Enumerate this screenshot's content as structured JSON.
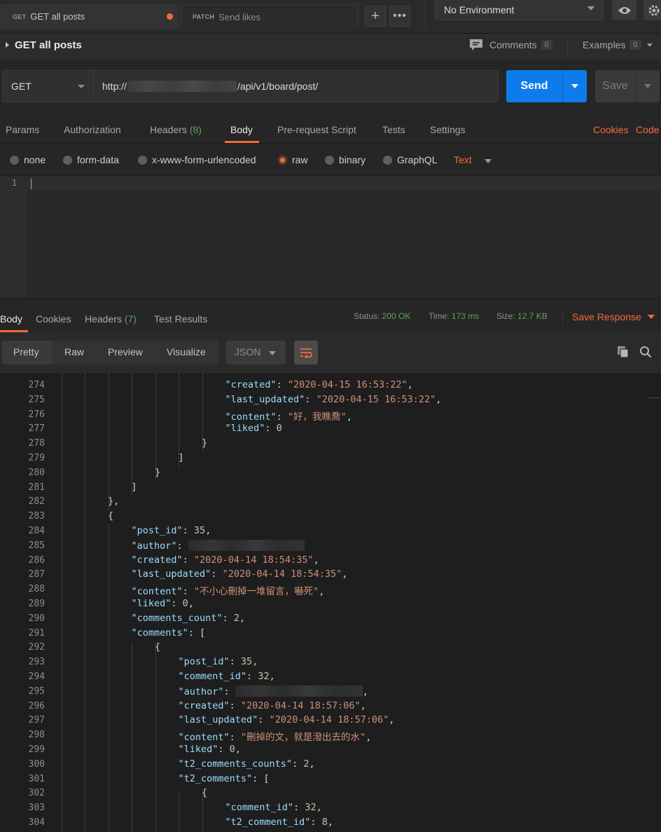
{
  "tabs": [
    {
      "method": "GET",
      "name": "GET all posts",
      "unsaved": true
    },
    {
      "method": "PATCH",
      "name": "Send likes"
    }
  ],
  "environment": "No Environment",
  "request": {
    "title": "GET all posts",
    "comments_label": "Comments",
    "comments_count": "0",
    "examples_label": "Examples",
    "examples_count": "0",
    "method": "GET",
    "url_prefix": "http://",
    "url_suffix": "/api/v1/board/post/",
    "send_label": "Send",
    "save_label": "Save"
  },
  "request_tabs": {
    "params": "Params",
    "authorization": "Authorization",
    "headers": "Headers",
    "headers_count": "(8)",
    "body": "Body",
    "prerequest": "Pre-request Script",
    "tests": "Tests",
    "settings": "Settings",
    "cookies": "Cookies",
    "code": "Code"
  },
  "body_types": {
    "none": "none",
    "form_data": "form-data",
    "urlencoded": "x-www-form-urlencoded",
    "raw": "raw",
    "binary": "binary",
    "graphql": "GraphQL",
    "text_type": "Text"
  },
  "editor": {
    "line1": "1"
  },
  "response": {
    "tabs": {
      "body": "Body",
      "cookies": "Cookies",
      "headers": "Headers",
      "headers_count": "(7)",
      "test_results": "Test Results"
    },
    "status_label": "Status:",
    "status": "200 OK",
    "time_label": "Time:",
    "time": "173 ms",
    "size_label": "Size:",
    "size": "12.7 KB",
    "save_response": "Save Response",
    "formats": {
      "pretty": "Pretty",
      "raw": "Raw",
      "preview": "Preview",
      "visualize": "Visualize"
    },
    "language": "JSON"
  },
  "code_lines": [
    {
      "n": "274",
      "i": 5,
      "t": [
        [
          "k",
          "\"created\""
        ],
        [
          "p",
          ": "
        ],
        [
          "s",
          "\"2020-04-15 16:53:22\""
        ],
        [
          "p",
          ","
        ]
      ]
    },
    {
      "n": "275",
      "i": 5,
      "t": [
        [
          "k",
          "\"last_updated\""
        ],
        [
          "p",
          ": "
        ],
        [
          "s",
          "\"2020-04-15 16:53:22\""
        ],
        [
          "p",
          ","
        ]
      ]
    },
    {
      "n": "276",
      "i": 5,
      "t": [
        [
          "k",
          "\"content\""
        ],
        [
          "p",
          ": "
        ],
        [
          "s",
          "\"好，我瞧喬\""
        ],
        [
          "p",
          ","
        ]
      ]
    },
    {
      "n": "277",
      "i": 5,
      "t": [
        [
          "k",
          "\"liked\""
        ],
        [
          "p",
          ": "
        ],
        [
          "n",
          "0"
        ]
      ]
    },
    {
      "n": "278",
      "i": 4,
      "t": [
        [
          "p",
          "}"
        ]
      ]
    },
    {
      "n": "279",
      "i": 3,
      "t": [
        [
          "p",
          "]"
        ]
      ]
    },
    {
      "n": "280",
      "i": 2,
      "t": [
        [
          "p",
          "}"
        ]
      ]
    },
    {
      "n": "281",
      "i": 1,
      "t": [
        [
          "p",
          "]"
        ]
      ]
    },
    {
      "n": "282",
      "i": 0,
      "t": [
        [
          "p",
          "},"
        ]
      ]
    },
    {
      "n": "283",
      "i": 0,
      "t": [
        [
          "p",
          "{"
        ]
      ]
    },
    {
      "n": "284",
      "i": 1,
      "t": [
        [
          "k",
          "\"post_id\""
        ],
        [
          "p",
          ": "
        ],
        [
          "n",
          "35"
        ],
        [
          "p",
          ","
        ]
      ]
    },
    {
      "n": "285",
      "i": 1,
      "t": [
        [
          "k",
          "\"author\""
        ],
        [
          "p",
          ": "
        ],
        [
          "b",
          "166"
        ]
      ]
    },
    {
      "n": "286",
      "i": 1,
      "t": [
        [
          "k",
          "\"created\""
        ],
        [
          "p",
          ": "
        ],
        [
          "s",
          "\"2020-04-14 18:54:35\""
        ],
        [
          "p",
          ","
        ]
      ]
    },
    {
      "n": "287",
      "i": 1,
      "t": [
        [
          "k",
          "\"last_updated\""
        ],
        [
          "p",
          ": "
        ],
        [
          "s",
          "\"2020-04-14 18:54:35\""
        ],
        [
          "p",
          ","
        ]
      ]
    },
    {
      "n": "288",
      "i": 1,
      "t": [
        [
          "k",
          "\"content\""
        ],
        [
          "p",
          ": "
        ],
        [
          "s",
          "\"不小心刪掉一堆留言，嚇死\""
        ],
        [
          "p",
          ","
        ]
      ]
    },
    {
      "n": "289",
      "i": 1,
      "t": [
        [
          "k",
          "\"liked\""
        ],
        [
          "p",
          ": "
        ],
        [
          "n",
          "0"
        ],
        [
          "p",
          ","
        ]
      ]
    },
    {
      "n": "290",
      "i": 1,
      "t": [
        [
          "k",
          "\"comments_count\""
        ],
        [
          "p",
          ": "
        ],
        [
          "n",
          "2"
        ],
        [
          "p",
          ","
        ]
      ]
    },
    {
      "n": "291",
      "i": 1,
      "t": [
        [
          "k",
          "\"comments\""
        ],
        [
          "p",
          ": ["
        ]
      ]
    },
    {
      "n": "292",
      "i": 2,
      "t": [
        [
          "p",
          "{"
        ]
      ]
    },
    {
      "n": "293",
      "i": 3,
      "t": [
        [
          "k",
          "\"post_id\""
        ],
        [
          "p",
          ": "
        ],
        [
          "n",
          "35"
        ],
        [
          "p",
          ","
        ]
      ]
    },
    {
      "n": "294",
      "i": 3,
      "t": [
        [
          "k",
          "\"comment_id\""
        ],
        [
          "p",
          ": "
        ],
        [
          "n",
          "32"
        ],
        [
          "p",
          ","
        ]
      ]
    },
    {
      "n": "295",
      "i": 3,
      "t": [
        [
          "k",
          "\"author\""
        ],
        [
          "p",
          ": "
        ],
        [
          "b",
          "182"
        ],
        [
          "p",
          ","
        ]
      ]
    },
    {
      "n": "296",
      "i": 3,
      "t": [
        [
          "k",
          "\"created\""
        ],
        [
          "p",
          ": "
        ],
        [
          "s",
          "\"2020-04-14 18:57:06\""
        ],
        [
          "p",
          ","
        ]
      ]
    },
    {
      "n": "297",
      "i": 3,
      "t": [
        [
          "k",
          "\"last_updated\""
        ],
        [
          "p",
          ": "
        ],
        [
          "s",
          "\"2020-04-14 18:57:06\""
        ],
        [
          "p",
          ","
        ]
      ]
    },
    {
      "n": "298",
      "i": 3,
      "t": [
        [
          "k",
          "\"content\""
        ],
        [
          "p",
          ": "
        ],
        [
          "s",
          "\"刪掉的文，就是潑出去的水\""
        ],
        [
          "p",
          ","
        ]
      ]
    },
    {
      "n": "299",
      "i": 3,
      "t": [
        [
          "k",
          "\"liked\""
        ],
        [
          "p",
          ": "
        ],
        [
          "n",
          "0"
        ],
        [
          "p",
          ","
        ]
      ]
    },
    {
      "n": "300",
      "i": 3,
      "t": [
        [
          "k",
          "\"t2_comments_counts\""
        ],
        [
          "p",
          ": "
        ],
        [
          "n",
          "2"
        ],
        [
          "p",
          ","
        ]
      ]
    },
    {
      "n": "301",
      "i": 3,
      "t": [
        [
          "k",
          "\"t2_comments\""
        ],
        [
          "p",
          ": ["
        ]
      ]
    },
    {
      "n": "302",
      "i": 4,
      "t": [
        [
          "p",
          "{"
        ]
      ]
    },
    {
      "n": "303",
      "i": 5,
      "t": [
        [
          "k",
          "\"comment_id\""
        ],
        [
          "p",
          ": "
        ],
        [
          "n",
          "32"
        ],
        [
          "p",
          ","
        ]
      ]
    },
    {
      "n": "304",
      "i": 5,
      "t": [
        [
          "k",
          "\"t2_comment_id\""
        ],
        [
          "p",
          ": "
        ],
        [
          "n",
          "8"
        ],
        [
          "p",
          ","
        ]
      ]
    }
  ]
}
